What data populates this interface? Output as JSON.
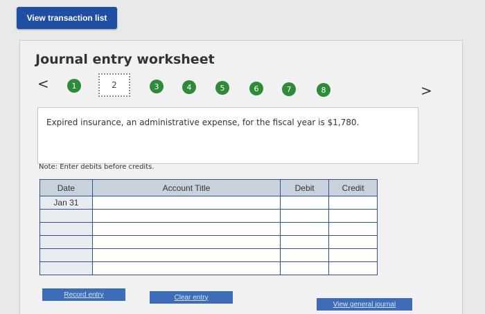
{
  "top_button": "View transaction list",
  "worksheet": {
    "title": "Journal entry worksheet",
    "prev_arrow": "<",
    "next_arrow": ">",
    "steps": [
      "1",
      "2",
      "3",
      "4",
      "5",
      "6",
      "7",
      "8"
    ],
    "active_step": "2",
    "description": "Expired insurance, an administrative expense, for the fiscal year is $1,780.",
    "note": "Note: Enter debits before credits."
  },
  "table": {
    "headers": {
      "date": "Date",
      "account": "Account Title",
      "debit": "Debit",
      "credit": "Credit"
    },
    "rows": [
      {
        "date": "Jan 31"
      },
      {
        "date": ""
      },
      {
        "date": ""
      },
      {
        "date": ""
      },
      {
        "date": ""
      },
      {
        "date": ""
      }
    ]
  },
  "buttons": {
    "record": "Record entry",
    "clear": "Clear entry",
    "view_journal": "View general journal"
  },
  "colors": {
    "primary": "#1f4ea3",
    "step_green": "#2f8a3a",
    "header_bg": "#c8d2dc"
  }
}
